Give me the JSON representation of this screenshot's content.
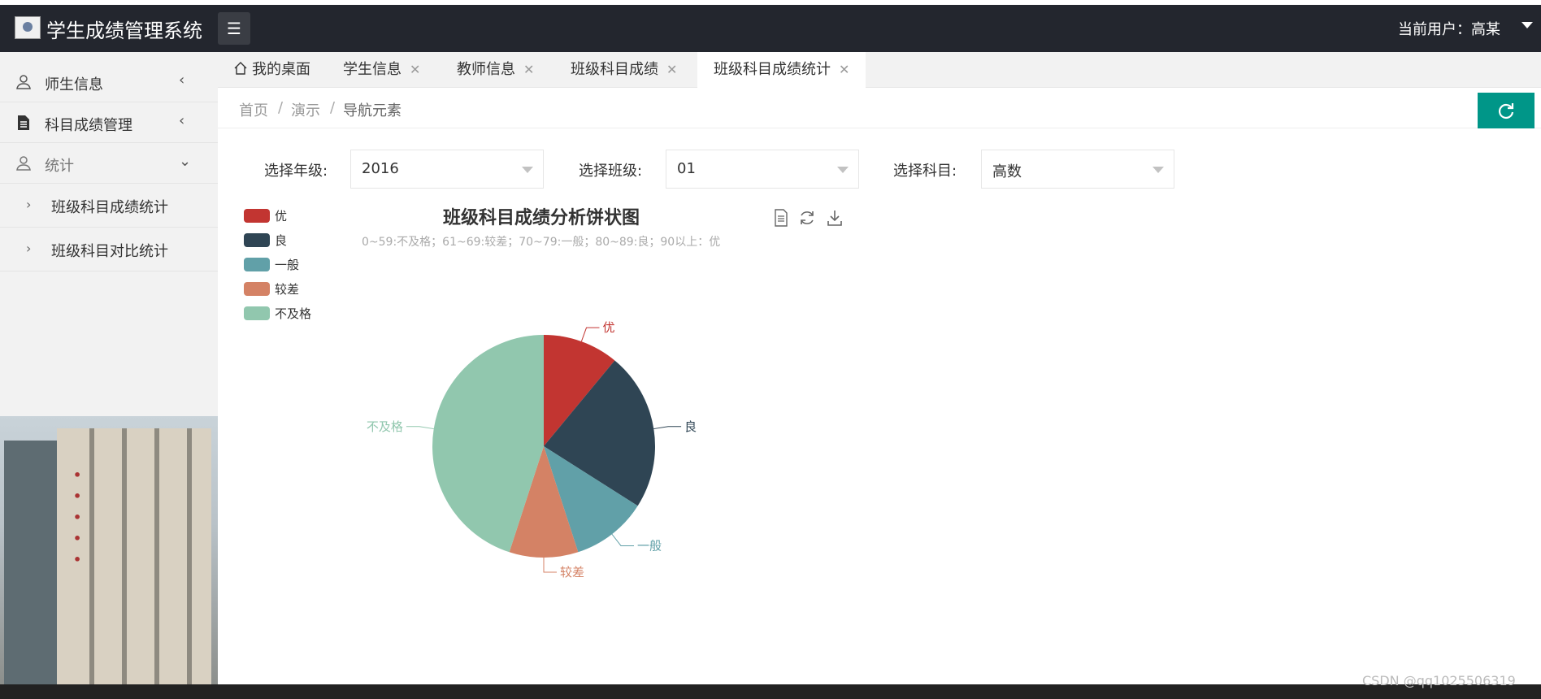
{
  "header": {
    "title": "学生成绩管理系统",
    "menu_icon": "menu-icon",
    "user_label": "当前用户：高某"
  },
  "sidebar": {
    "items": [
      {
        "label": "师生信息",
        "icon": "user-icon",
        "arrow": "‹"
      },
      {
        "label": "科目成绩管理",
        "icon": "document-icon",
        "arrow": "‹"
      },
      {
        "label": "统计",
        "icon": "user-icon",
        "arrow": "⌄"
      }
    ],
    "sub_items": [
      {
        "label": "班级科目成绩统计"
      },
      {
        "label": "班级科目对比统计"
      }
    ]
  },
  "tabs": [
    {
      "label": "我的桌面",
      "closable": false
    },
    {
      "label": "学生信息",
      "closable": true
    },
    {
      "label": "教师信息",
      "closable": true
    },
    {
      "label": "班级科目成绩",
      "closable": true
    },
    {
      "label": "班级科目成绩统计",
      "closable": true,
      "active": true
    }
  ],
  "breadcrumb": [
    "首页",
    "演示",
    "导航元素"
  ],
  "breadcrumb_sep": "/",
  "filters": [
    {
      "label": "选择年级:",
      "value": "2016"
    },
    {
      "label": "选择班级:",
      "value": "01"
    },
    {
      "label": "选择科目:",
      "value": "高数"
    }
  ],
  "colors": {
    "accent": "#009688",
    "header_bg": "#23262e"
  },
  "chart_data": {
    "type": "pie",
    "title": "班级科目成绩分析饼状图",
    "subtitle": "0~59:不及格；61~69:较差；70~79:一般；80~89:良；90以上：优",
    "legend_position": "top-left",
    "slices": [
      {
        "name": "优",
        "value": 11,
        "color": "#c23531"
      },
      {
        "name": "良",
        "value": 23,
        "color": "#2f4554"
      },
      {
        "name": "一般",
        "value": 11,
        "color": "#61a0a8"
      },
      {
        "name": "较差",
        "value": 10,
        "color": "#d48265"
      },
      {
        "name": "不及格",
        "value": 45,
        "color": "#91c7ae"
      }
    ]
  },
  "watermark": "CSDN @qq1025506319"
}
